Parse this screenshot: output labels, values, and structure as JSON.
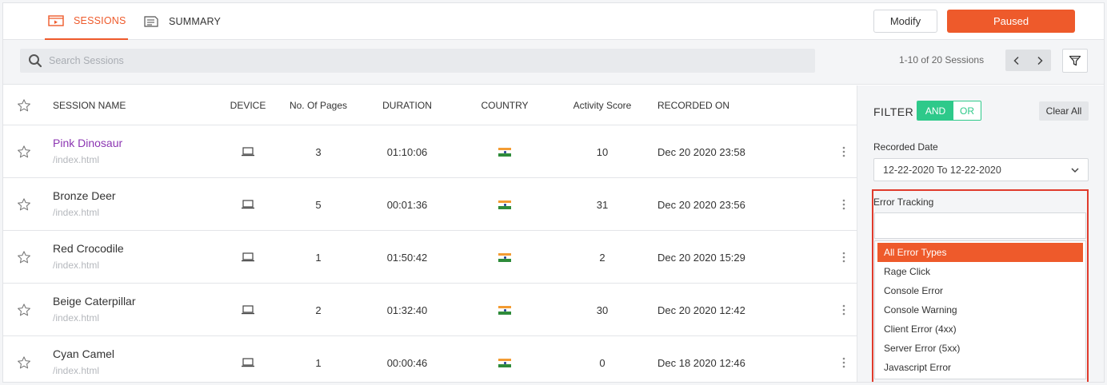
{
  "nav": {
    "tabs": [
      {
        "label": "SESSIONS",
        "icon": "sessions-icon",
        "active": true
      },
      {
        "label": "SUMMARY",
        "icon": "summary-icon",
        "active": false
      }
    ],
    "modify_label": "Modify",
    "paused_label": "Paused"
  },
  "search": {
    "placeholder": "Search Sessions",
    "pager_text": "1-10 of 20 Sessions"
  },
  "table": {
    "headers": {
      "name": "SESSION NAME",
      "device": "DEVICE",
      "pages": "No. Of Pages",
      "duration": "DURATION",
      "country": "COUNTRY",
      "activity": "Activity Score",
      "recorded": "RECORDED ON"
    },
    "rows": [
      {
        "name": "Pink Dinosaur",
        "url": "/index.html",
        "pages": "3",
        "duration": "01:10:06",
        "activity": "10",
        "recorded": "Dec 20 2020 23:58",
        "visited": true
      },
      {
        "name": "Bronze Deer",
        "url": "/index.html",
        "pages": "5",
        "duration": "00:01:36",
        "activity": "31",
        "recorded": "Dec 20 2020 23:56",
        "visited": false
      },
      {
        "name": "Red Crocodile",
        "url": "/index.html",
        "pages": "1",
        "duration": "01:50:42",
        "activity": "2",
        "recorded": "Dec 20 2020 15:29",
        "visited": false
      },
      {
        "name": "Beige Caterpillar",
        "url": "/index.html",
        "pages": "2",
        "duration": "01:32:40",
        "activity": "30",
        "recorded": "Dec 20 2020 12:42",
        "visited": false
      },
      {
        "name": "Cyan Camel",
        "url": "/index.html",
        "pages": "1",
        "duration": "00:00:46",
        "activity": "0",
        "recorded": "Dec 18 2020 12:46",
        "visited": false
      }
    ]
  },
  "filter": {
    "title": "FILTER",
    "and_label": "AND",
    "or_label": "OR",
    "clear_label": "Clear All",
    "recorded_date_label": "Recorded Date",
    "recorded_date_value": "12-22-2020 To 12-22-2020",
    "error_tracking_label": "Error Tracking",
    "error_options": [
      "All Error Types",
      "Rage Click",
      "Console Error",
      "Console Warning",
      "Client Error (4xx)",
      "Server Error (5xx)",
      "Javascript Error"
    ],
    "selected_option": "All Error Types"
  },
  "colors": {
    "accent": "#ee5a2b",
    "toggle_green": "#2ec98a",
    "visited_link": "#8c36b2",
    "highlight_border": "#e03b2c"
  }
}
